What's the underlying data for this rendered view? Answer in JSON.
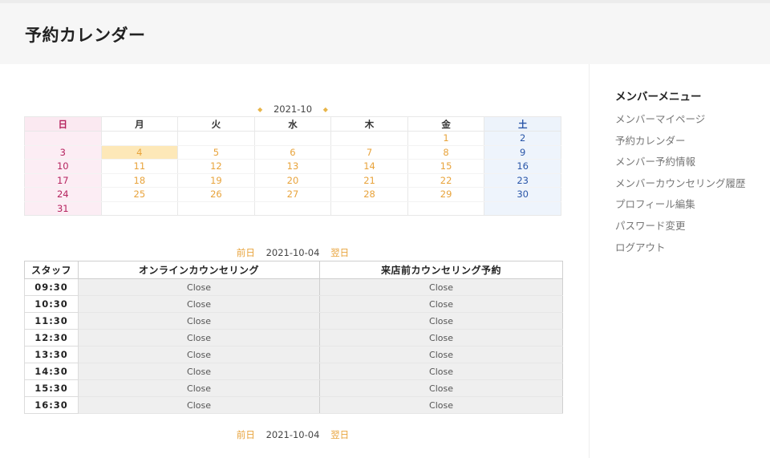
{
  "header": {
    "title": "予約カレンダー"
  },
  "sidebar": {
    "title": "メンバーメニュー",
    "items": [
      {
        "label": "メンバーマイページ"
      },
      {
        "label": "予約カレンダー"
      },
      {
        "label": "メンバー予約情報"
      },
      {
        "label": "メンバーカウンセリング履歴"
      },
      {
        "label": "プロフィール編集"
      },
      {
        "label": "パスワード変更"
      },
      {
        "label": "ログアウト"
      }
    ]
  },
  "calendar": {
    "month": "2021-10",
    "prev_arrow": "◆",
    "next_arrow": "◆",
    "weekdays": [
      "日",
      "月",
      "火",
      "水",
      "木",
      "金",
      "土"
    ],
    "today": "4",
    "weeks": [
      [
        "",
        "",
        "",
        "",
        "",
        "1",
        "2"
      ],
      [
        "3",
        "4",
        "5",
        "6",
        "7",
        "8",
        "9"
      ],
      [
        "10",
        "11",
        "12",
        "13",
        "14",
        "15",
        "16"
      ],
      [
        "17",
        "18",
        "19",
        "20",
        "21",
        "22",
        "23"
      ],
      [
        "24",
        "25",
        "26",
        "27",
        "28",
        "29",
        "30"
      ],
      [
        "31",
        "",
        "",
        "",
        "",
        "",
        ""
      ]
    ]
  },
  "day_nav": {
    "prev": "前日",
    "date": "2021-10-04",
    "next": "翌日"
  },
  "schedule": {
    "columns": [
      "スタッフ",
      "オンラインカウンセリング",
      "来店前カウンセリング予約"
    ],
    "rows": [
      {
        "time": "09:30",
        "slots": [
          "Close",
          "Close"
        ]
      },
      {
        "time": "10:30",
        "slots": [
          "Close",
          "Close"
        ]
      },
      {
        "time": "11:30",
        "slots": [
          "Close",
          "Close"
        ]
      },
      {
        "time": "12:30",
        "slots": [
          "Close",
          "Close"
        ]
      },
      {
        "time": "13:30",
        "slots": [
          "Close",
          "Close"
        ]
      },
      {
        "time": "14:30",
        "slots": [
          "Close",
          "Close"
        ]
      },
      {
        "time": "15:30",
        "slots": [
          "Close",
          "Close"
        ]
      },
      {
        "time": "16:30",
        "slots": [
          "Close",
          "Close"
        ]
      }
    ]
  },
  "colors": {
    "accent": "#e8a33b",
    "sunday": "#b5245f",
    "saturday": "#2a56a8",
    "today_bg": "#fde8b8"
  }
}
